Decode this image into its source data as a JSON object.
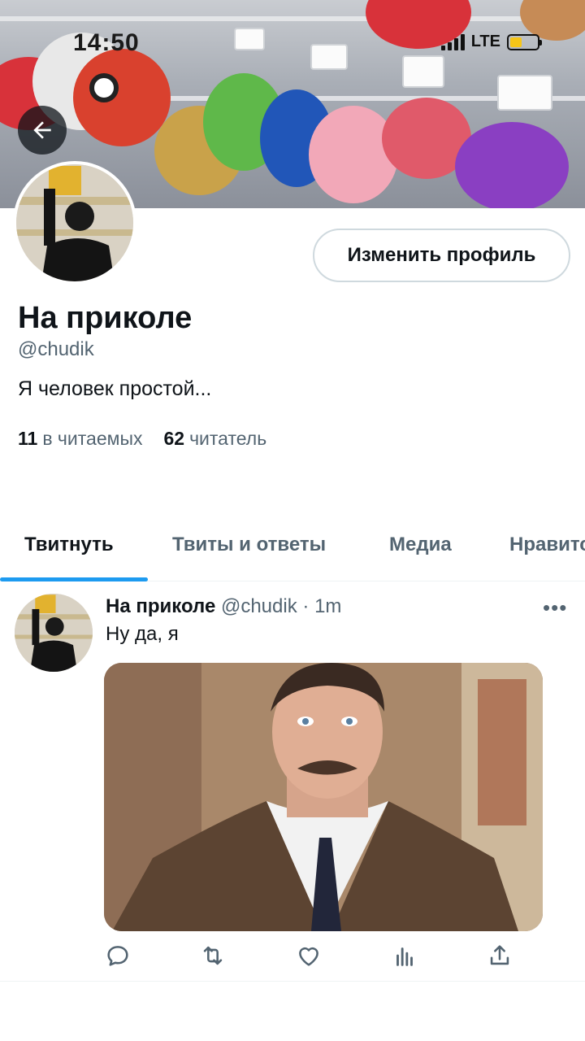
{
  "status_bar": {
    "time": "14:50",
    "network": "LTE"
  },
  "profile": {
    "edit_button_label": "Изменить профиль",
    "display_name": "На приколе",
    "handle": "@chudik",
    "bio": "Я человек простой...",
    "following_count": "11",
    "following_label": "в читаемых",
    "followers_count": "62",
    "followers_label": "читатель"
  },
  "tabs": [
    {
      "label": "Твитнуть",
      "active": true
    },
    {
      "label": "Твиты и ответы",
      "active": false
    },
    {
      "label": "Медиа",
      "active": false
    },
    {
      "label": "Нравится",
      "active": false
    }
  ],
  "tweet": {
    "author_name": "На приколе",
    "author_handle": "@chudik",
    "separator": "·",
    "time": "1m",
    "more": "•••",
    "text": "Ну да, я"
  },
  "icons": {
    "back": "arrow-left-icon",
    "reply": "reply-icon",
    "retweet": "retweet-icon",
    "like": "heart-icon",
    "views": "analytics-icon",
    "share": "share-icon"
  },
  "colors": {
    "accent": "#1d9bf0",
    "battery": "#f5c518",
    "secondary_text": "#536471"
  }
}
